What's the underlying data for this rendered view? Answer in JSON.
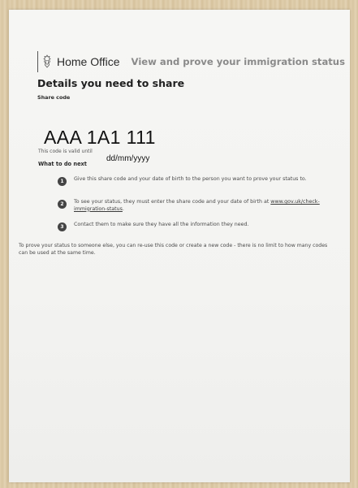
{
  "header": {
    "brand": "Home Office",
    "service_name": "View and prove your immigration status"
  },
  "main": {
    "heading": "Details you need to share",
    "share_code_label": "Share code",
    "share_code": "AAA 1A1 111",
    "valid_until_label": "This code is valid until",
    "valid_until_date": "dd/mm/yyyy",
    "what_next_heading": "What to do next",
    "steps": [
      {
        "number": "1",
        "text": "Give this share code and your date of birth to the person you want to prove your status to."
      },
      {
        "number": "2",
        "text_before_link": "To see your status, they must enter the share code and your date of birth at ",
        "link": "www.gov.uk/check-immigration-status",
        "text_after_link": "."
      },
      {
        "number": "3",
        "text": "Contact them to make sure they have all the information they need."
      }
    ],
    "footer": "To prove your status to someone else, you can re-use this code or create a new code - there is no limit to how many codes can be used at the same time."
  },
  "icons": {
    "crest": "royal-coat-of-arms-icon"
  }
}
